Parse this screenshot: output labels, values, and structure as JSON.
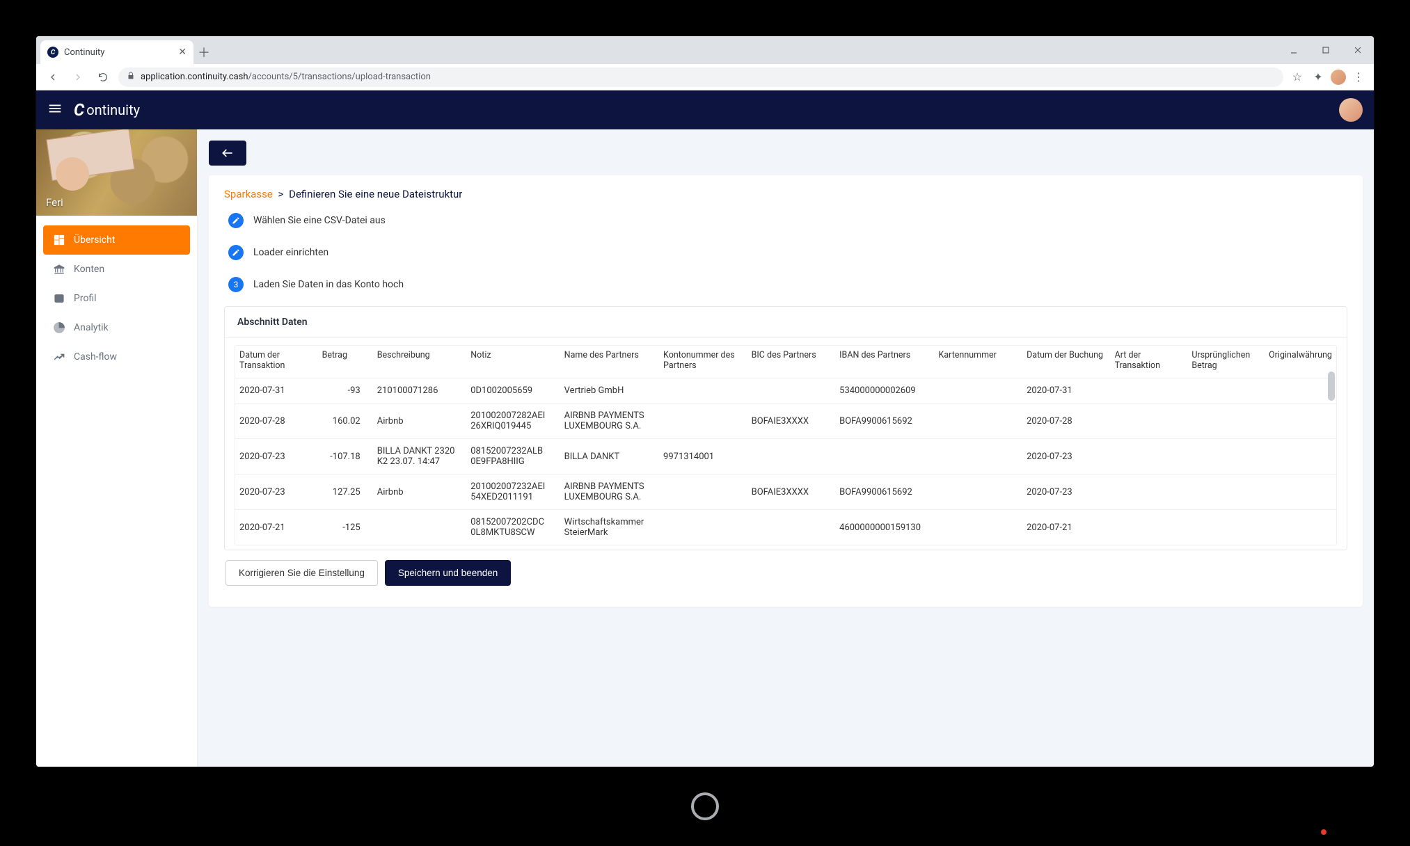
{
  "browser": {
    "tab_title": "Continuity",
    "url_host": "application.continuity.cash",
    "url_path": "/accounts/5/transactions/upload-transaction"
  },
  "header": {
    "brand": "ontinuity"
  },
  "sidebar": {
    "user": "Feri",
    "items": [
      {
        "label": "Übersicht",
        "icon": "dashboard"
      },
      {
        "label": "Konten",
        "icon": "bank"
      },
      {
        "label": "Profil",
        "icon": "profile"
      },
      {
        "label": "Analytik",
        "icon": "pie"
      },
      {
        "label": "Cash-flow",
        "icon": "trend"
      }
    ]
  },
  "page": {
    "crumb_a": "Sparkasse",
    "crumb_sep": ">",
    "crumb_b": "Definieren Sie eine neue Dateistruktur",
    "steps": [
      "Wählen Sie eine CSV-Datei aus",
      "Loader einrichten",
      "Laden Sie Daten in das Konto hoch"
    ],
    "section_title": "Abschnitt Daten",
    "columns": [
      "Datum der Transaktion",
      "Betrag",
      "Beschreibung",
      "Notiz",
      "Name des Partners",
      "Kontonummer des Partners",
      "BIC des Partners",
      "IBAN des Partners",
      "Kartennummer",
      "Datum der Buchung",
      "Art der Transaktion",
      "Ursprünglichen Betrag",
      "Originalwährung"
    ],
    "rows": [
      {
        "date": "2020-07-31",
        "amount": "-93",
        "desc": "210100071286",
        "note": "0D1002005659",
        "partner": "Vertrieb GmbH",
        "acct": "",
        "bic": "",
        "iban": "534000000002609",
        "card": "",
        "book": "2020-07-31"
      },
      {
        "date": "2020-07-28",
        "amount": "160.02",
        "desc": "Airbnb",
        "note": "201002007282AEI 26XRIQ019445",
        "partner": "AIRBNB PAYMENTS LUXEMBOURG S.A.",
        "acct": "",
        "bic": "BOFAIE3XXXX",
        "iban": "BOFA9900615692",
        "card": "",
        "book": "2020-07-28"
      },
      {
        "date": "2020-07-23",
        "amount": "-107.18",
        "desc": "BILLA DANKT 2320 K2 23.07. 14:47",
        "note": "08152007232ALB 0E9FPA8HIIG",
        "partner": "BILLA DANKT",
        "acct": "9971314001",
        "bic": "",
        "iban": "",
        "card": "",
        "book": "2020-07-23"
      },
      {
        "date": "2020-07-23",
        "amount": "127.25",
        "desc": "Airbnb",
        "note": "201002007232AEI 54XED2011191",
        "partner": "AIRBNB PAYMENTS LUXEMBOURG S.A.",
        "acct": "",
        "bic": "BOFAIE3XXXX",
        "iban": "BOFA9900615692",
        "card": "",
        "book": "2020-07-23"
      },
      {
        "date": "2020-07-21",
        "amount": "-125",
        "desc": "",
        "note": "08152007202CDC 0L8MKTU8SCW",
        "partner": "Wirtschaftskammer SteierMark",
        "acct": "",
        "bic": "",
        "iban": "4600000000159130",
        "card": "",
        "book": "2020-07-21"
      }
    ],
    "btn_correct": "Korrigieren Sie die Einstellung",
    "btn_save": "Speichern und beenden"
  }
}
